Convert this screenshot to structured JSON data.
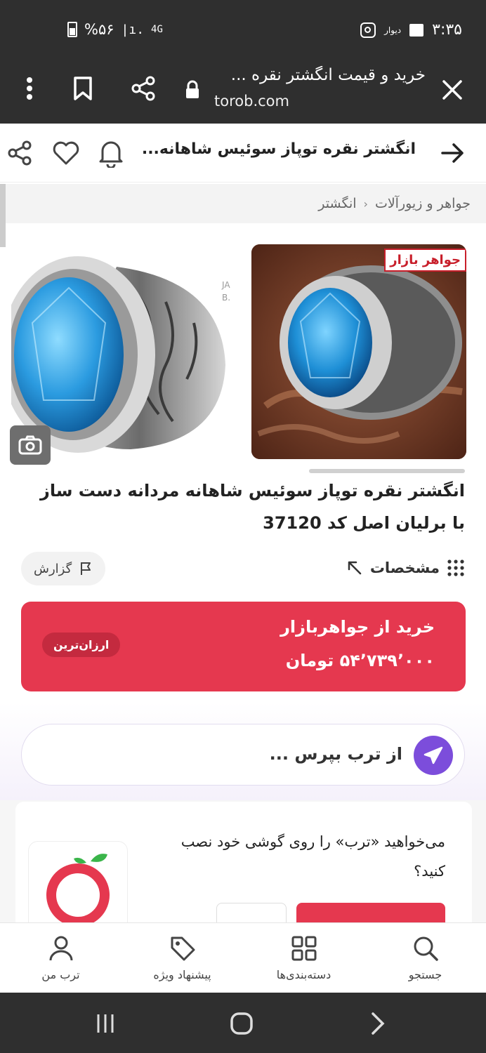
{
  "status_bar": {
    "time": "۳:۳۵",
    "app_label": "دیوار",
    "battery": "%۵۶",
    "network": "4G"
  },
  "browser": {
    "page_title": "خرید و قیمت انگشتر نقره ...",
    "url": "torob.com"
  },
  "header": {
    "title": "انگشتر نقره توپاز سوئیس شاهانه..."
  },
  "breadcrumb": [
    "جواهر و زیورآلات",
    "انگشتر"
  ],
  "gallery": {
    "shop_badge": "جواهر بازار"
  },
  "product": {
    "title_line1": "انگشتر نقره توپاز سوئیس شاهانه مردانه دست ساز",
    "title_line2": "با برلیان اصل کد 37120"
  },
  "specs": {
    "label": "مشخصات",
    "report_label": "گزارش"
  },
  "buy": {
    "shop": "خرید از جواهربازار",
    "price": "۵۴٬۷۳۹٬۰۰۰ تومان",
    "badge": "ارزان‌ترین"
  },
  "ask": {
    "placeholder": "از ترب بپرس ..."
  },
  "promo": {
    "text": "می‌خواهید «ترب» را روی گوشی خود نصب کنید؟"
  },
  "bottom_nav": [
    {
      "label": "جستجو",
      "icon": "search-icon"
    },
    {
      "label": "دسته‌بندی‌ها",
      "icon": "grid-icon"
    },
    {
      "label": "پیشنهاد ویژه",
      "icon": "tag-icon"
    },
    {
      "label": "ترب من",
      "icon": "user-icon"
    }
  ],
  "colors": {
    "primary": "#e5384f",
    "purple": "#7c4ddb",
    "dark_bar": "#2f2f2f"
  }
}
